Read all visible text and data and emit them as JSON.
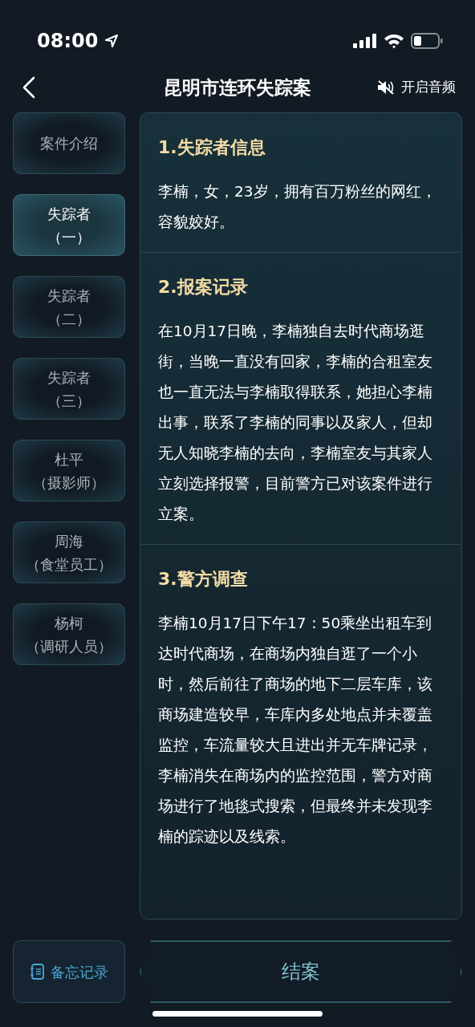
{
  "status_bar": {
    "time": "08:00"
  },
  "header": {
    "title": "昆明市连环失踪案",
    "audio_label": "开启音频"
  },
  "sidebar": {
    "items": [
      {
        "lines": [
          "案件介绍"
        ],
        "selected": false
      },
      {
        "lines": [
          "失踪者",
          "（一）"
        ],
        "selected": true
      },
      {
        "lines": [
          "失踪者",
          "（二）"
        ],
        "selected": false
      },
      {
        "lines": [
          "失踪者",
          "（三）"
        ],
        "selected": false
      },
      {
        "lines": [
          "杜平",
          "（摄影师）"
        ],
        "selected": false
      },
      {
        "lines": [
          "周海",
          "（食堂员工）"
        ],
        "selected": false
      },
      {
        "lines": [
          "杨柯",
          "（调研人员）"
        ],
        "selected": false
      }
    ]
  },
  "sections": [
    {
      "heading": "1.失踪者信息",
      "body": "李楠，女，23岁，拥有百万粉丝的网红，容貌姣好。"
    },
    {
      "heading": "2.报案记录",
      "body": "在10月17日晚，李楠独自去时代商场逛街，当晚一直没有回家，李楠的合租室友也一直无法与李楠取得联系，她担心李楠出事，联系了李楠的同事以及家人，但却无人知晓李楠的去向，李楠室友与其家人立刻选择报警，目前警方已对该案件进行立案。"
    },
    {
      "heading": "3.警方调查",
      "body": "李楠10月17日下午17：50乘坐出租车到达时代商场，在商场内独自逛了一个小时，然后前往了商场的地下二层车库，该商场建造较早，车库内多处地点并未覆盖监控，车流量较大且进出并无车牌记录，李楠消失在商场内的监控范围，警方对商场进行了地毯式搜索，但最终并未发现李楠的踪迹以及线索。"
    }
  ],
  "footer": {
    "memo_label": "备忘记录",
    "close_label": "结案"
  }
}
